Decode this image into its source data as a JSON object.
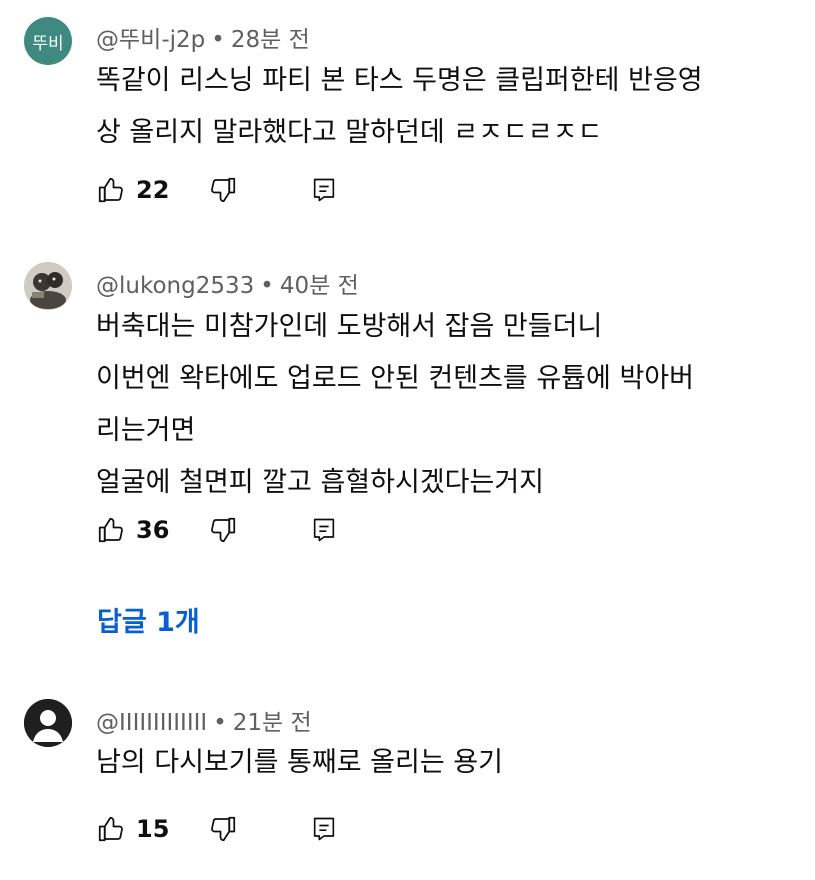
{
  "comments": [
    {
      "avatar_text": "뚜비",
      "author": "@뚜비-j2p",
      "time": "28분 전",
      "lines": [
        "똑같이 리스닝 파티 본 타스 두명은 클립퍼한테 반응영",
        "상 올리지 말라했다고 말하던데 ㄹㅈㄷㄹㅈㄷ"
      ],
      "likes": "22"
    },
    {
      "author": "@lukong2533",
      "time": "40분 전",
      "lines": [
        "버축대는 미참가인데 도방해서 잡음 만들더니",
        "이번엔 왁타에도 업로드 안된 컨텐츠를 유튭에 박아버",
        "리는거면",
        "얼굴에 철면피 깔고 흡혈하시겠다는거지"
      ],
      "likes": "36",
      "replies": "답글 1개"
    },
    {
      "author": "@IIIIIIIIIIIII",
      "time": "21분 전",
      "lines": [
        "남의 다시보기를 통째로 올리는 용기"
      ],
      "likes": "15"
    }
  ],
  "colors": {
    "accent_link": "#065fd4",
    "avatar_bg": "#3f8a80",
    "meta_text": "#606060"
  },
  "icons": [
    "thumb-up-icon",
    "thumb-down-icon",
    "reply-icon",
    "default-avatar-icon"
  ]
}
